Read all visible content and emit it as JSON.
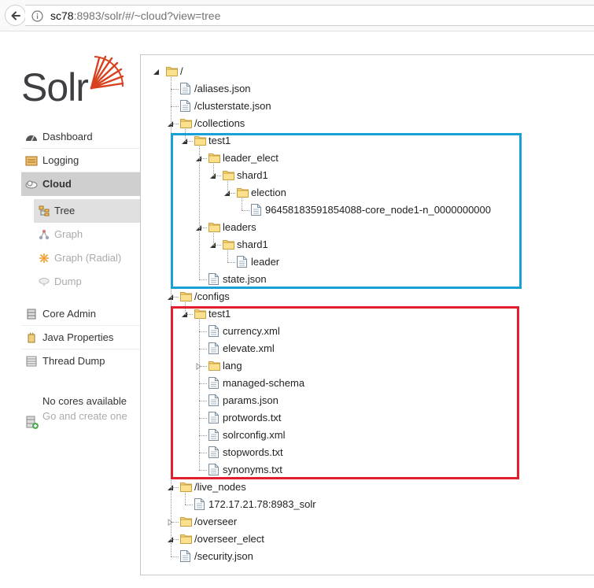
{
  "browser": {
    "url_host": "sc78",
    "url_rest": ":8983/solr/#/~cloud?view=tree"
  },
  "logo": {
    "text": "Solr",
    "accent": "#d9411e"
  },
  "sidebar": {
    "items": [
      {
        "id": "dashboard",
        "label": "Dashboard",
        "icon": "dashboard-icon"
      },
      {
        "id": "logging",
        "label": "Logging",
        "icon": "logging-icon"
      },
      {
        "id": "cloud",
        "label": "Cloud",
        "icon": "cloud-icon",
        "active": true
      },
      {
        "id": "core-admin",
        "label": "Core Admin",
        "icon": "core-admin-icon"
      },
      {
        "id": "java-properties",
        "label": "Java Properties",
        "icon": "java-icon"
      },
      {
        "id": "thread-dump",
        "label": "Thread Dump",
        "icon": "thread-dump-icon"
      }
    ],
    "cloud_sub": [
      {
        "id": "tree",
        "label": "Tree",
        "icon": "tree-icon",
        "active": true
      },
      {
        "id": "graph",
        "label": "Graph",
        "icon": "graph-icon"
      },
      {
        "id": "graph-radial",
        "label": "Graph (Radial)",
        "icon": "graph-radial-icon"
      },
      {
        "id": "dump",
        "label": "Dump",
        "icon": "dump-icon"
      }
    ],
    "no_cores": {
      "line1": "No cores available",
      "line2": "Go and create one"
    }
  },
  "tree": [
    {
      "label": "/",
      "type": "folder",
      "depth": 0
    },
    {
      "label": "/aliases.json",
      "type": "file",
      "depth": 1
    },
    {
      "label": "/clusterstate.json",
      "type": "file",
      "depth": 1
    },
    {
      "label": "/collections",
      "type": "folder",
      "depth": 1
    },
    {
      "label": "test1",
      "type": "folder",
      "depth": 2
    },
    {
      "label": "leader_elect",
      "type": "folder",
      "depth": 3
    },
    {
      "label": "shard1",
      "type": "folder",
      "depth": 4
    },
    {
      "label": "election",
      "type": "folder",
      "depth": 5
    },
    {
      "label": "96458183591854088-core_node1-n_0000000000",
      "type": "file",
      "depth": 6
    },
    {
      "label": "leaders",
      "type": "folder",
      "depth": 3
    },
    {
      "label": "shard1",
      "type": "folder",
      "depth": 4
    },
    {
      "label": "leader",
      "type": "file",
      "depth": 5
    },
    {
      "label": "state.json",
      "type": "file",
      "depth": 3
    },
    {
      "label": "/configs",
      "type": "folder",
      "depth": 1
    },
    {
      "label": "test1",
      "type": "folder",
      "depth": 2
    },
    {
      "label": "currency.xml",
      "type": "file",
      "depth": 3
    },
    {
      "label": "elevate.xml",
      "type": "file",
      "depth": 3
    },
    {
      "label": "lang",
      "type": "folder",
      "depth": 3,
      "collapsed": true
    },
    {
      "label": "managed-schema",
      "type": "file",
      "depth": 3
    },
    {
      "label": "params.json",
      "type": "file",
      "depth": 3
    },
    {
      "label": "protwords.txt",
      "type": "file",
      "depth": 3
    },
    {
      "label": "solrconfig.xml",
      "type": "file",
      "depth": 3
    },
    {
      "label": "stopwords.txt",
      "type": "file",
      "depth": 3
    },
    {
      "label": "synonyms.txt",
      "type": "file",
      "depth": 3
    },
    {
      "label": "/live_nodes",
      "type": "folder",
      "depth": 1
    },
    {
      "label": "172.17.21.78:8983_solr",
      "type": "file",
      "depth": 2
    },
    {
      "label": "/overseer",
      "type": "folder",
      "depth": 1,
      "collapsed": true
    },
    {
      "label": "/overseer_elect",
      "type": "folder",
      "depth": 1
    },
    {
      "label": "/security.json",
      "type": "file",
      "depth": 1
    }
  ],
  "highlights": [
    {
      "name": "collections-highlight",
      "color": "#1aa0d8"
    },
    {
      "name": "configs-highlight",
      "color": "#e0202e"
    }
  ]
}
